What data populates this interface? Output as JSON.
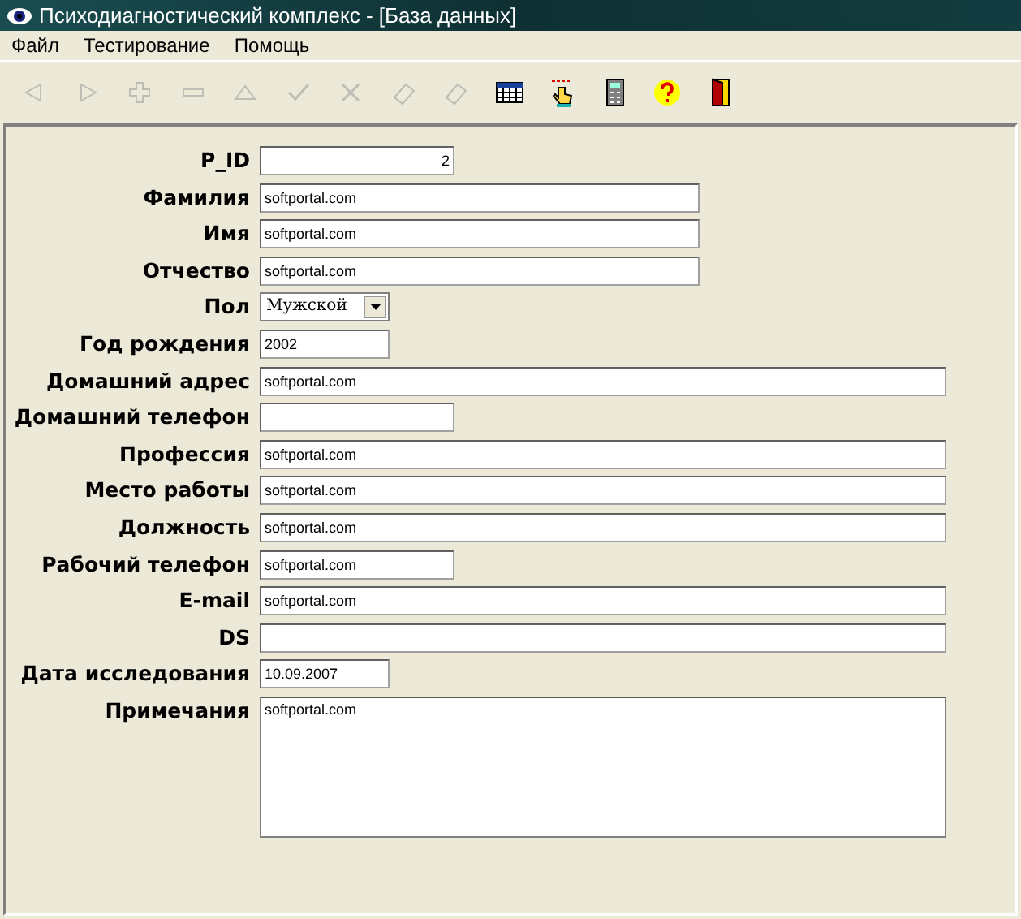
{
  "window": {
    "title": "Психодиагностический комплекс - [База данных]"
  },
  "menu": [
    "Файл",
    "Тестирование",
    "Помощь"
  ],
  "toolbar": [
    {
      "kind": "prev",
      "disabled": true
    },
    {
      "kind": "next",
      "disabled": true
    },
    {
      "kind": "add",
      "disabled": true
    },
    {
      "kind": "delete",
      "disabled": true
    },
    {
      "kind": "up",
      "disabled": true
    },
    {
      "kind": "check",
      "disabled": true
    },
    {
      "kind": "cancel",
      "disabled": true
    },
    {
      "kind": "eraser",
      "disabled": true
    },
    {
      "kind": "eraser",
      "disabled": true
    },
    {
      "kind": "table",
      "disabled": false
    },
    {
      "kind": "hand",
      "disabled": false
    },
    {
      "kind": "calculator",
      "disabled": false
    },
    {
      "kind": "help",
      "disabled": false
    },
    {
      "kind": "exit",
      "disabled": false
    }
  ],
  "fields": [
    {
      "label": "P_ID",
      "kind": "number",
      "value": "2"
    },
    {
      "label": "Фамилия",
      "kind": "text",
      "value": "softportal.com"
    },
    {
      "label": "Имя",
      "kind": "text",
      "value": "softportal.com"
    },
    {
      "label": "Отчество",
      "kind": "text",
      "value": "softportal.com"
    },
    {
      "label": "Пол",
      "kind": "select",
      "value": "Мужской"
    },
    {
      "label": "Год рождения",
      "kind": "text",
      "value": "2002"
    },
    {
      "label": "Домашний адрес",
      "kind": "text",
      "value": "softportal.com"
    },
    {
      "label": "Домашний телефон",
      "kind": "text"
    },
    {
      "label": "Профессия",
      "kind": "text",
      "value": "softportal.com"
    },
    {
      "label": "Место работы",
      "kind": "text",
      "value": "softportal.com"
    },
    {
      "label": "Должность",
      "kind": "text",
      "value": "softportal.com"
    },
    {
      "label": "Рабочий телефон",
      "kind": "text",
      "value": "softportal.com"
    },
    {
      "label": "E-mail",
      "kind": "text",
      "value": "softportal.com"
    },
    {
      "label": "DS",
      "kind": "text"
    },
    {
      "label": "Дата исследования",
      "kind": "text",
      "value": "10.09.2007"
    },
    {
      "label": "Примечания",
      "kind": "memo",
      "value": "softportal.com"
    }
  ]
}
